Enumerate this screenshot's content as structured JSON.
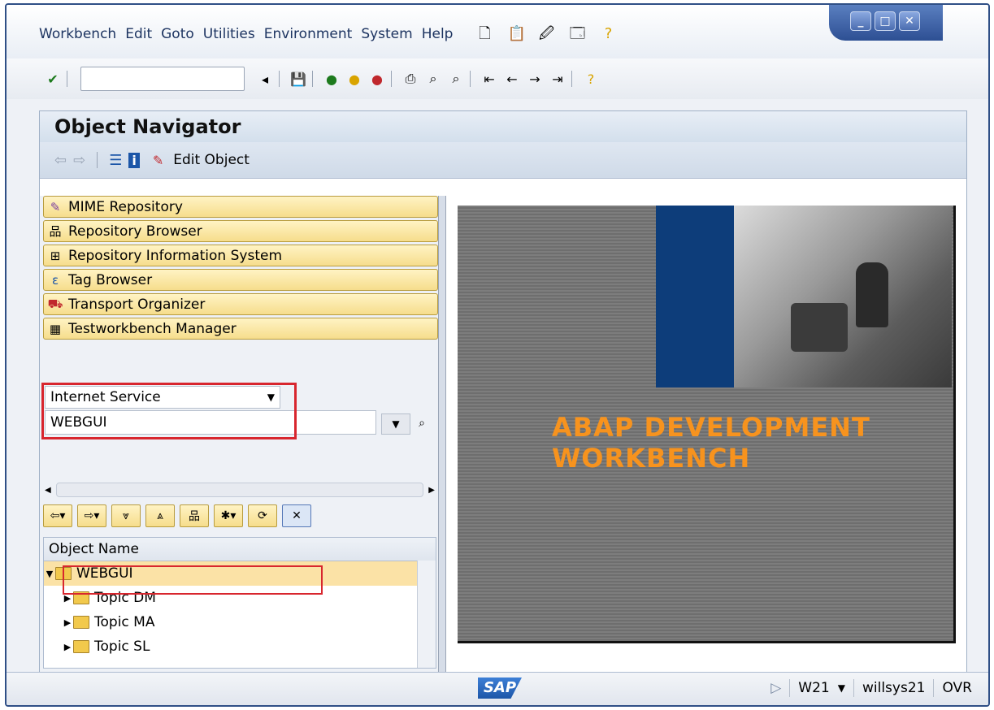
{
  "menu": [
    "Workbench",
    "Edit",
    "Goto",
    "Utilities",
    "Environment",
    "System",
    "Help"
  ],
  "app": {
    "title": "Object Navigator",
    "edit_object_label": "Edit Object"
  },
  "nav_buttons": [
    {
      "label": "MIME Repository",
      "icon": "mime-icon"
    },
    {
      "label": "Repository Browser",
      "icon": "tree-icon"
    },
    {
      "label": "Repository Information System",
      "icon": "info-system-icon"
    },
    {
      "label": "Tag Browser",
      "icon": "tag-icon"
    },
    {
      "label": "Transport Organizer",
      "icon": "truck-icon"
    },
    {
      "label": "Testworkbench Manager",
      "icon": "test-icon"
    }
  ],
  "object_selector": {
    "type": "Internet Service",
    "value": "WEBGUI"
  },
  "tree": {
    "header": "Object Name",
    "rows": [
      {
        "label": "WEBGUI",
        "expanded": true,
        "selected": true
      },
      {
        "label": "Topic DM"
      },
      {
        "label": "Topic MA"
      },
      {
        "label": "Topic SL"
      }
    ]
  },
  "banner": {
    "line1": "ABAP DEVELOPMENT",
    "line2": "WORKBENCH",
    "accent": "#f7931e"
  },
  "status": {
    "logo": "SAP",
    "system": "W21",
    "host": "willsys21",
    "mode": "OVR"
  }
}
